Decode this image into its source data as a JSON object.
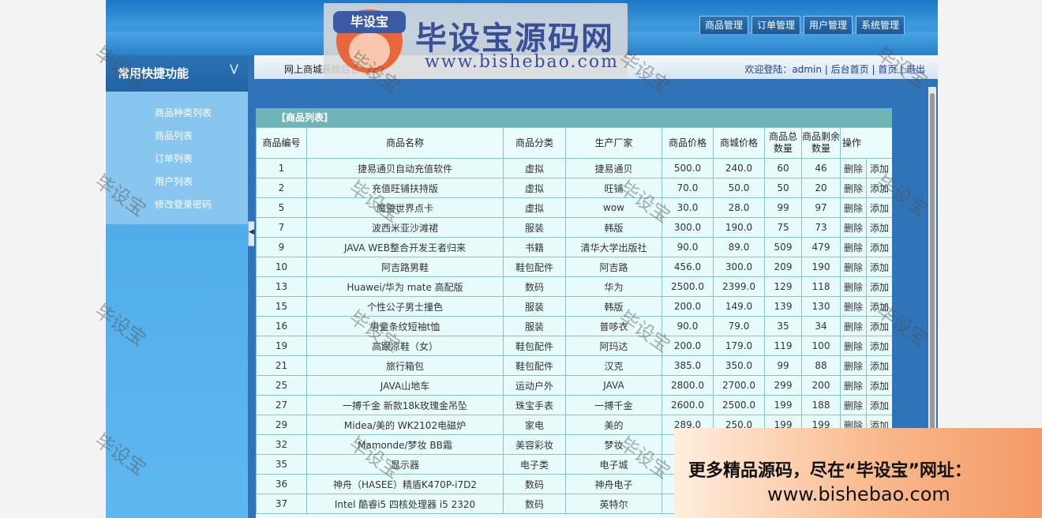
{
  "topnav": [
    "商品管理",
    "订单管理",
    "用户管理",
    "系统管理"
  ],
  "logo": {
    "badge": "毕设宝",
    "title": "毕设宝源码网",
    "url": "www.bishebao.com"
  },
  "sidebar": {
    "title": "常用快捷功能",
    "items": [
      "商品种类列表",
      "商品列表",
      "订单列表",
      "用户列表",
      "修改登录密码"
    ]
  },
  "crumb": {
    "title": "网上商城系统后台管理",
    "welcome": "欢迎登陆：",
    "user": "admin",
    "links": [
      "后台首页",
      "首页",
      "退出"
    ]
  },
  "table": {
    "caption": "【商品列表】",
    "headers": [
      "商品编号",
      "商品名称",
      "商品分类",
      "生产厂家",
      "商品价格",
      "商城价格",
      "商品总数量",
      "商品剩余数量",
      "操作"
    ],
    "rows": [
      [
        "1",
        "捷易通贝自动充值软件",
        "虚拟",
        "捷易通贝",
        "500.0",
        "240.0",
        "60",
        "46",
        "删除",
        "添加"
      ],
      [
        "2",
        "充值旺铺扶持版",
        "虚拟",
        "旺铺",
        "70.0",
        "50.0",
        "50",
        "20",
        "删除",
        "添加"
      ],
      [
        "5",
        "魔兽世界点卡",
        "虚拟",
        "wow",
        "30.0",
        "28.0",
        "99",
        "97",
        "删除",
        "添加"
      ],
      [
        "7",
        "波西米亚沙滩裙",
        "服装",
        "韩版",
        "300.0",
        "190.0",
        "75",
        "73",
        "删除",
        "添加"
      ],
      [
        "9",
        "JAVA WEB整合开发王者归来",
        "书籍",
        "清华大学出版社",
        "90.0",
        "89.0",
        "509",
        "479",
        "删除",
        "添加"
      ],
      [
        "10",
        "阿吉路男鞋",
        "鞋包配件",
        "阿吉路",
        "456.0",
        "300.0",
        "209",
        "190",
        "删除",
        "添加"
      ],
      [
        "13",
        "Huawei/华为 mate 高配版",
        "数码",
        "华为",
        "2500.0",
        "2399.0",
        "129",
        "118",
        "删除",
        "添加"
      ],
      [
        "15",
        "个性公子男士撞色",
        "服装",
        "韩版",
        "200.0",
        "149.0",
        "139",
        "130",
        "删除",
        "添加"
      ],
      [
        "16",
        "男童条纹短袖t恤",
        "服装",
        "普哆衣",
        "90.0",
        "79.0",
        "35",
        "34",
        "删除",
        "添加"
      ],
      [
        "19",
        "高跟凉鞋（女）",
        "鞋包配件",
        "阿玛达",
        "200.0",
        "179.0",
        "119",
        "100",
        "删除",
        "添加"
      ],
      [
        "21",
        "旅行箱包",
        "鞋包配件",
        "汉克",
        "385.0",
        "350.0",
        "99",
        "88",
        "删除",
        "添加"
      ],
      [
        "25",
        "JAVA山地车",
        "运动户外",
        "JAVA",
        "2800.0",
        "2700.0",
        "299",
        "200",
        "删除",
        "添加"
      ],
      [
        "27",
        "一搏千金 新款18k玫瑰金吊坠",
        "珠宝手表",
        "一搏千金",
        "2600.0",
        "2500.0",
        "199",
        "188",
        "删除",
        "添加"
      ],
      [
        "29",
        "Midea/美的 WK2102电磁炉",
        "家电",
        "美的",
        "289.0",
        "250.0",
        "199",
        "199",
        "删除",
        "添加"
      ],
      [
        "32",
        "Mamonde/梦妆 BB霜",
        "美容彩妆",
        "梦妆",
        "",
        "",
        "",
        "",
        "",
        ""
      ],
      [
        "35",
        "显示器",
        "电子类",
        "电子城",
        "",
        "",
        "",
        "",
        "",
        ""
      ],
      [
        "36",
        "神舟（HASEE）精盾K470P-i7D2",
        "数码",
        "神舟电子",
        "",
        "",
        "",
        "",
        "",
        ""
      ],
      [
        "37",
        "Intel 酷睿i5 四核处理器 i5 2320",
        "数码",
        "英特尔",
        "",
        "",
        "",
        "",
        "",
        ""
      ]
    ]
  },
  "watermark_text": "毕设宝",
  "promo": {
    "line1": "更多精品源码，尽在“毕设宝”网址：",
    "line2": "www.bishebao.com"
  }
}
